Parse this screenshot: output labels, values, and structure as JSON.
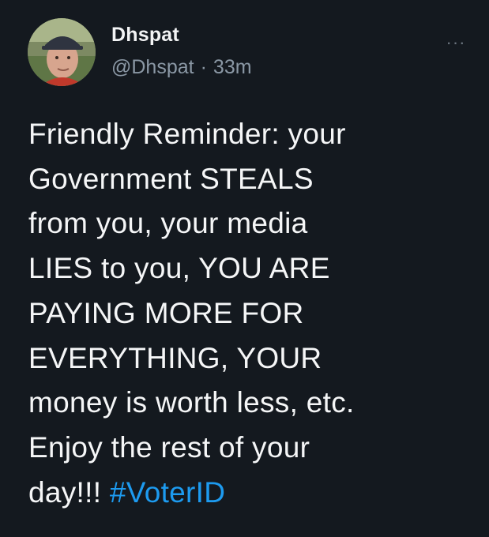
{
  "tweet": {
    "author": {
      "display_name": "Dhspat",
      "handle": "@Dhspat",
      "time_ago": "33m",
      "separator": "·"
    },
    "more_icon": "more-horizontal-icon",
    "text": "Friendly Reminder:  your\nGovernment STEALS\nfrom you, your media\nLIES to you, YOU ARE\nPAYING MORE FOR\nEVERYTHING, YOUR\nmoney is worth less, etc.\nEnjoy the rest of your\nday!!! ",
    "hashtag": "#VoterID",
    "colors": {
      "background": "#14191f",
      "text": "#f5f6f7",
      "secondary": "#8b98a5",
      "hashtag": "#1d9bf0"
    }
  }
}
